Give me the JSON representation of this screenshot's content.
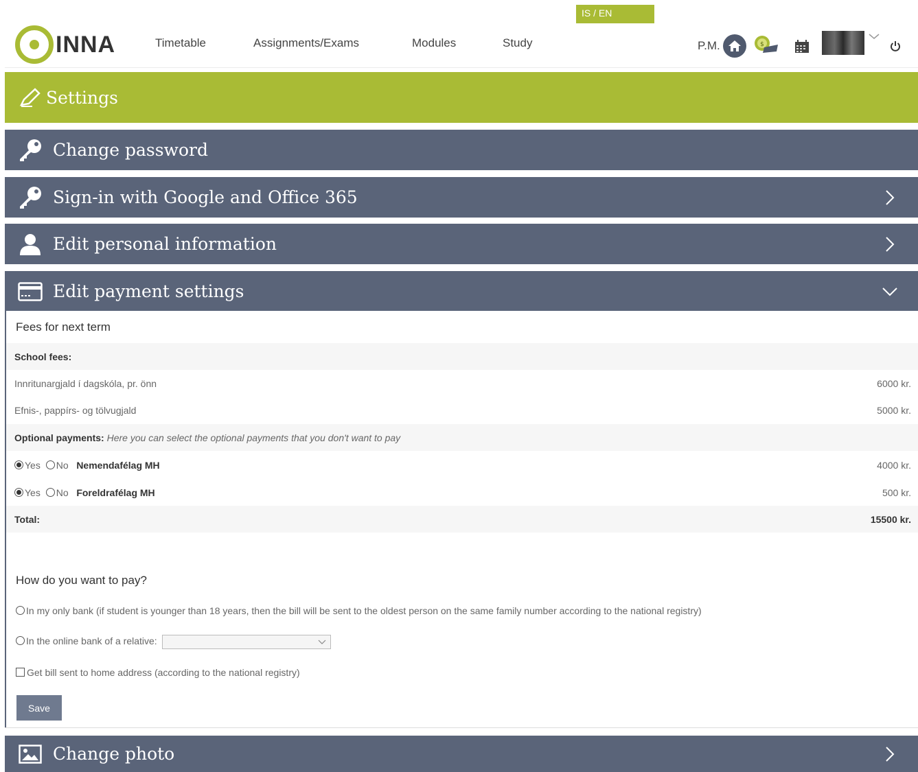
{
  "lang_switch": "IS / EN",
  "logo": {
    "text": "INNA"
  },
  "nav": [
    "Timetable",
    "Assignments/Exams",
    "Modules",
    "Study"
  ],
  "user": {
    "initials": "P.M."
  },
  "icons": {
    "home": "home-icon",
    "coin": "coin-icon",
    "calendar": "calendar-icon",
    "avatar": "avatar",
    "power": "power-icon"
  },
  "settings_title": "Settings",
  "panels": {
    "change_password": "Change password",
    "google": "Sign-in with Google and Office 365",
    "personal": "Edit personal information",
    "payment": "Edit payment settings",
    "photo": "Change photo"
  },
  "payment": {
    "fees_title": "Fees for next term",
    "school_fees_label": "School fees:",
    "fees": [
      {
        "label": "Innritunargjald í dagskóla, pr. önn",
        "amount": "6000 kr."
      },
      {
        "label": "Efnis-, pappírs- og tölvugjald",
        "amount": "5000 kr."
      }
    ],
    "optional_label": "Optional payments:",
    "optional_hint": "Here you can select the optional payments that you don't want to pay",
    "optional": [
      {
        "yes": "Yes",
        "no": "No",
        "name": "Nemendafélag MH",
        "amount": "4000 kr.",
        "selected": "yes"
      },
      {
        "yes": "Yes",
        "no": "No",
        "name": "Foreldrafélag MH",
        "amount": "500 kr.",
        "selected": "yes"
      }
    ],
    "total_label": "Total:",
    "total_amount": "15500 kr.",
    "how_title": "How do you want to pay?",
    "option_bank": "In my only bank (if student is younger than 18 years, then the bill will be sent to the oldest person on the same family number according to the national registry)",
    "option_relative": "In the online bank of a relative:",
    "option_home": "Get bill sent to home address (according to the national registry)",
    "save": "Save"
  },
  "colors": {
    "accent": "#a9bb35",
    "panel": "#5a6479"
  }
}
